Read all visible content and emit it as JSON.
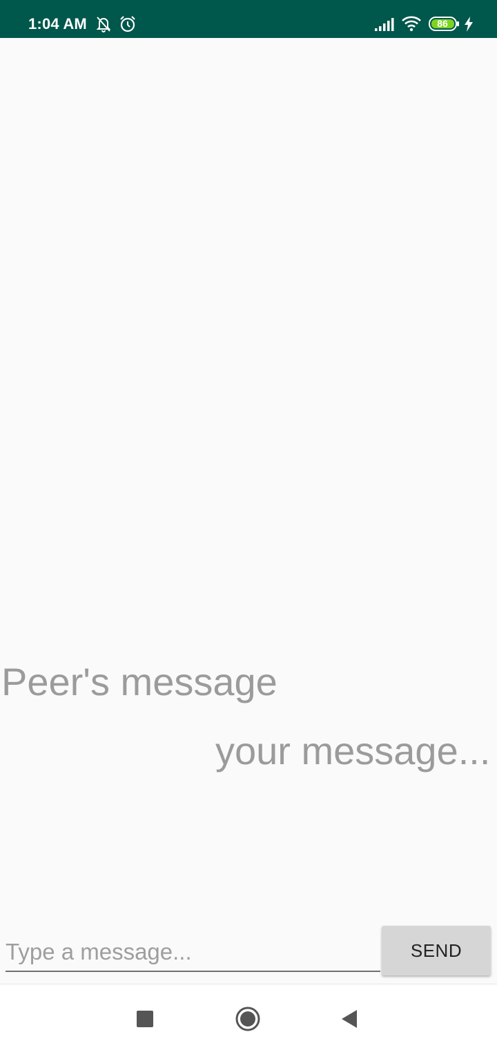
{
  "status_bar": {
    "time": "1:04 AM",
    "battery_level": "86",
    "icons": [
      "mute-icon",
      "alarm-icon",
      "signal-icon",
      "wifi-icon",
      "battery-icon",
      "charging-icon"
    ],
    "background_color": "#00574b"
  },
  "chat": {
    "peer_message": "Peer's message",
    "my_message": "your message..."
  },
  "composer": {
    "input_value": "",
    "input_placeholder": "Type a message...",
    "send_label": "SEND"
  },
  "nav_bar": {
    "buttons": [
      "recents-icon",
      "home-icon",
      "back-icon"
    ]
  }
}
